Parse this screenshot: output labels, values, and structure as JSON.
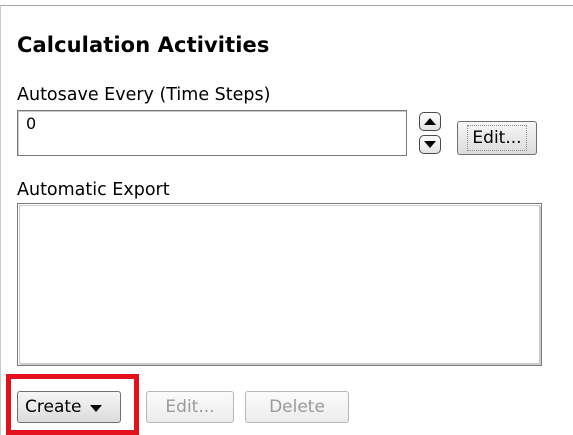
{
  "panel": {
    "title": "Calculation Activities"
  },
  "autosave": {
    "label": "Autosave Every (Time Steps)",
    "value": "0",
    "edit_label": "Edit..."
  },
  "automatic_export": {
    "label": "Automatic Export",
    "items": []
  },
  "actions": {
    "create_label": "Create",
    "edit_label": "Edit...",
    "delete_label": "Delete"
  },
  "icons": {
    "spin_up": "spin-up-arrow-icon",
    "spin_down": "spin-down-arrow-icon",
    "dropdown": "dropdown-arrow-icon"
  },
  "colors": {
    "highlight": "#e3111b"
  }
}
